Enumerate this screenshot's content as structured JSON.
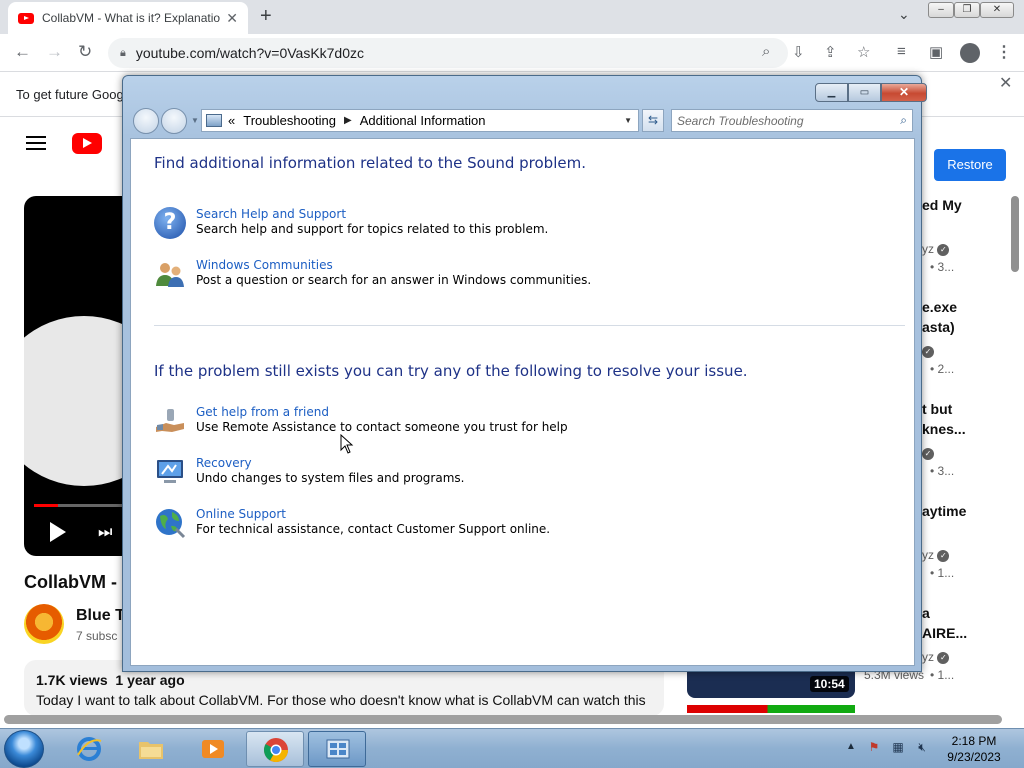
{
  "browser": {
    "tab_title": "CollabVM - What is it? Explanation",
    "url": "youtube.com/watch?v=0VasKk7d0zc"
  },
  "youtube": {
    "infobar_text": "To get future Goog",
    "restore_label": "Restore",
    "video_title": "CollabVM -",
    "channel_name": "Blue T",
    "channel_subs": "7 subsc",
    "views": "1.7K views",
    "age": "1 year ago",
    "description": "Today I want to talk about CollabVM. For those who doesn't know what is CollabVM can watch this",
    "sidebar_fragments": [
      "ed My",
      "yz",
      "• 3...",
      "e.exe",
      "asta)",
      "• 2...",
      "t but",
      "knes...",
      "• 3...",
      "aytime",
      "yz",
      "• 1...",
      "a",
      "AIRE...",
      "yz",
      "5.3M views",
      "• 1..."
    ],
    "thumb_duration": "10:54"
  },
  "dialog": {
    "breadcrumb": [
      "Troubleshooting",
      "Additional Information"
    ],
    "breadcrumb_prefix": "«",
    "search_placeholder": "Search Troubleshooting",
    "heading1": "Find additional information related to the Sound problem.",
    "heading2": "If the problem still exists you can try any of the following to resolve your issue.",
    "items1": [
      {
        "link": "Search Help and Support",
        "desc": "Search help and support for topics related to this problem.",
        "icon": "help-icon"
      },
      {
        "link": "Windows Communities",
        "desc": "Post a question or search for an answer in Windows communities.",
        "icon": "people-icon"
      }
    ],
    "items2": [
      {
        "link": "Get help from a friend",
        "desc": "Use Remote Assistance to contact someone you trust for help",
        "icon": "remote-assistance-icon"
      },
      {
        "link": "Recovery",
        "desc": "Undo changes to system files and programs.",
        "icon": "recovery-icon"
      },
      {
        "link": "Online Support",
        "desc": "For technical assistance, contact Customer Support online.",
        "icon": "globe-icon"
      }
    ]
  },
  "taskbar": {
    "time": "2:18 PM",
    "date": "9/23/2023"
  },
  "colors": {
    "link_blue": "#1c5ec3",
    "heading_blue": "#1e3287",
    "yt_red": "#ff0000",
    "restore_blue": "#1a73e8"
  }
}
